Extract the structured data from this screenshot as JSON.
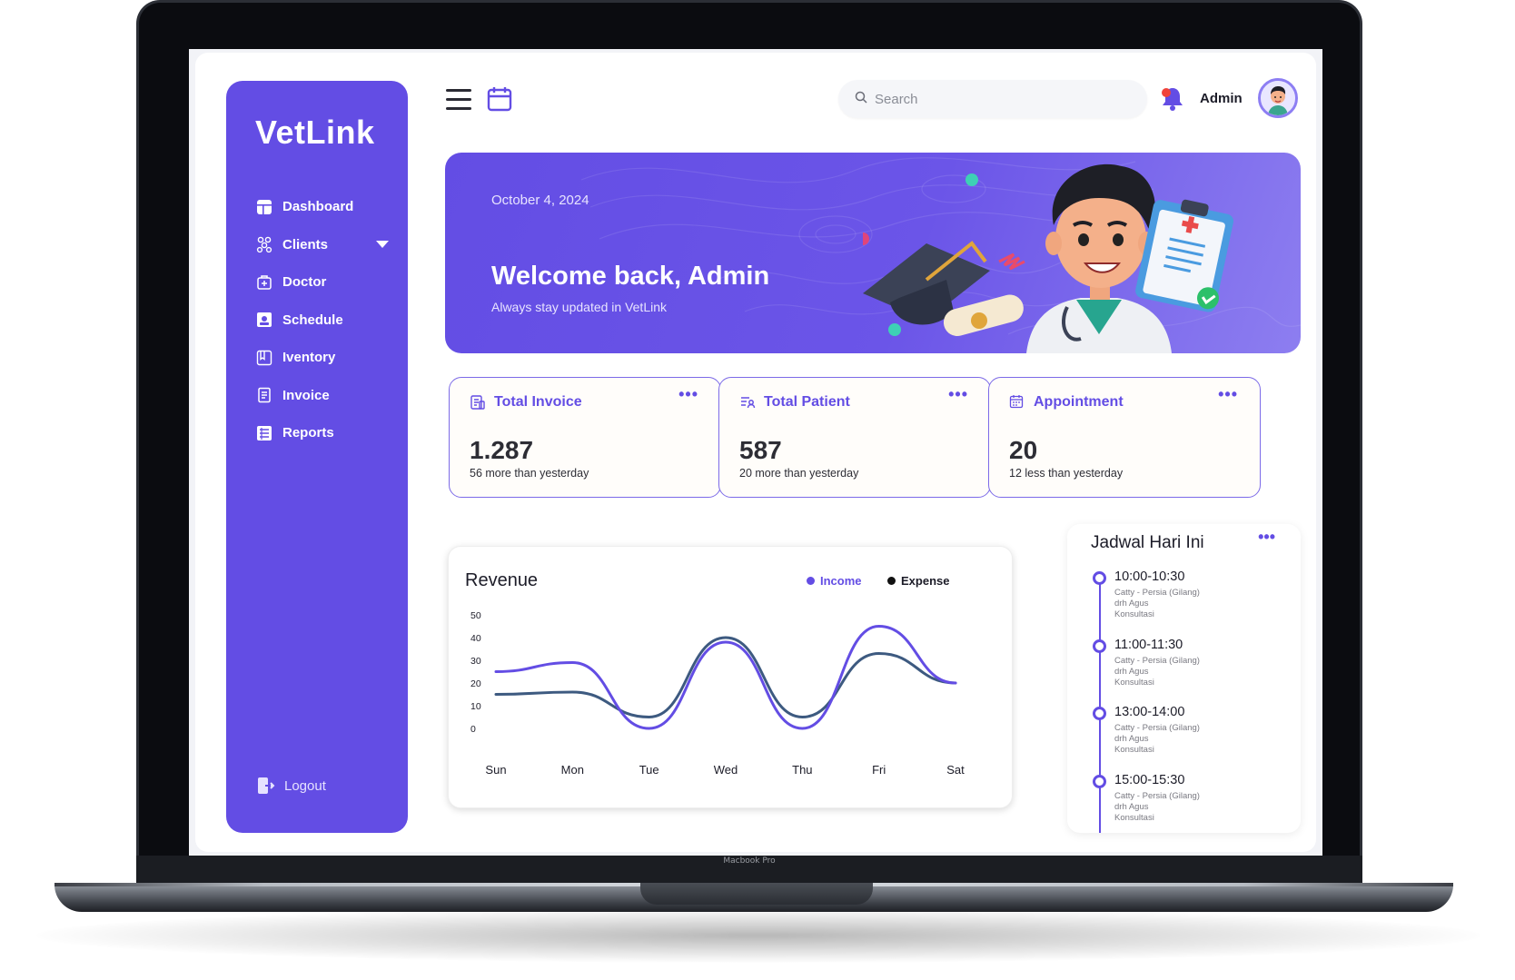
{
  "device": {
    "label": "Macbook Pro"
  },
  "sidebar": {
    "brand": "VetLink",
    "items": [
      {
        "label": "Dashboard",
        "icon": "dashboard-icon"
      },
      {
        "label": "Clients",
        "icon": "clients-icon"
      },
      {
        "label": "Doctor",
        "icon": "doctor-icon"
      },
      {
        "label": "Schedule",
        "icon": "schedule-icon"
      },
      {
        "label": "Iventory",
        "icon": "inventory-icon"
      },
      {
        "label": "Invoice",
        "icon": "invoice-icon"
      },
      {
        "label": "Reports",
        "icon": "reports-icon"
      }
    ],
    "logout": "Logout"
  },
  "topbar": {
    "search_placeholder": "Search",
    "user_name": "Admin"
  },
  "banner": {
    "date": "October 4,  2024",
    "title": "Welcome back, Admin",
    "subtitle": "Always stay updated in VetLink"
  },
  "stats": [
    {
      "title": "Total Invoice",
      "value": "1.287",
      "note": "56 more than yesterday",
      "icon": "invoice-icon"
    },
    {
      "title": "Total Patient",
      "value": "587",
      "note": "20 more than yesterday",
      "icon": "patient-icon"
    },
    {
      "title": "Appointment",
      "value": "20",
      "note": "12 less than yesterday",
      "icon": "calendar-icon"
    }
  ],
  "revenue": {
    "title": "Revenue",
    "legend_income": "Income",
    "legend_expense": "Expense"
  },
  "chart_data": {
    "type": "line",
    "title": "Revenue",
    "categories": [
      "Sun",
      "Mon",
      "Tue",
      "Wed",
      "Thu",
      "Fri",
      "Sat"
    ],
    "y_ticks": [
      0,
      10,
      20,
      30,
      40,
      50
    ],
    "ylim": [
      0,
      50
    ],
    "series": [
      {
        "name": "Income",
        "color": "#634de4",
        "values": [
          25,
          29,
          0,
          38,
          0,
          45,
          20
        ]
      },
      {
        "name": "Expense",
        "color": "#3d5a80",
        "values": [
          15,
          16,
          5,
          40,
          5,
          33,
          20
        ]
      }
    ],
    "smooth": true,
    "legend_position": "top-right"
  },
  "schedule": {
    "title": "Jadwal Hari Ini",
    "slots": [
      {
        "time": "10:00-10:30",
        "patient": "Catty - Persia (Gilang)",
        "doctor": "drh Agus",
        "type": "Konsultasi"
      },
      {
        "time": "11:00-11:30",
        "patient": "Catty - Persia (Gilang)",
        "doctor": "drh Agus",
        "type": "Konsultasi"
      },
      {
        "time": "13:00-14:00",
        "patient": "Catty - Persia (Gilang)",
        "doctor": "drh Agus",
        "type": "Konsultasi"
      },
      {
        "time": "15:00-15:30",
        "patient": "Catty - Persia (Gilang)",
        "doctor": "drh Agus",
        "type": "Konsultasi"
      }
    ]
  },
  "colors": {
    "primary": "#634de4",
    "expense": "#3d5a80"
  }
}
